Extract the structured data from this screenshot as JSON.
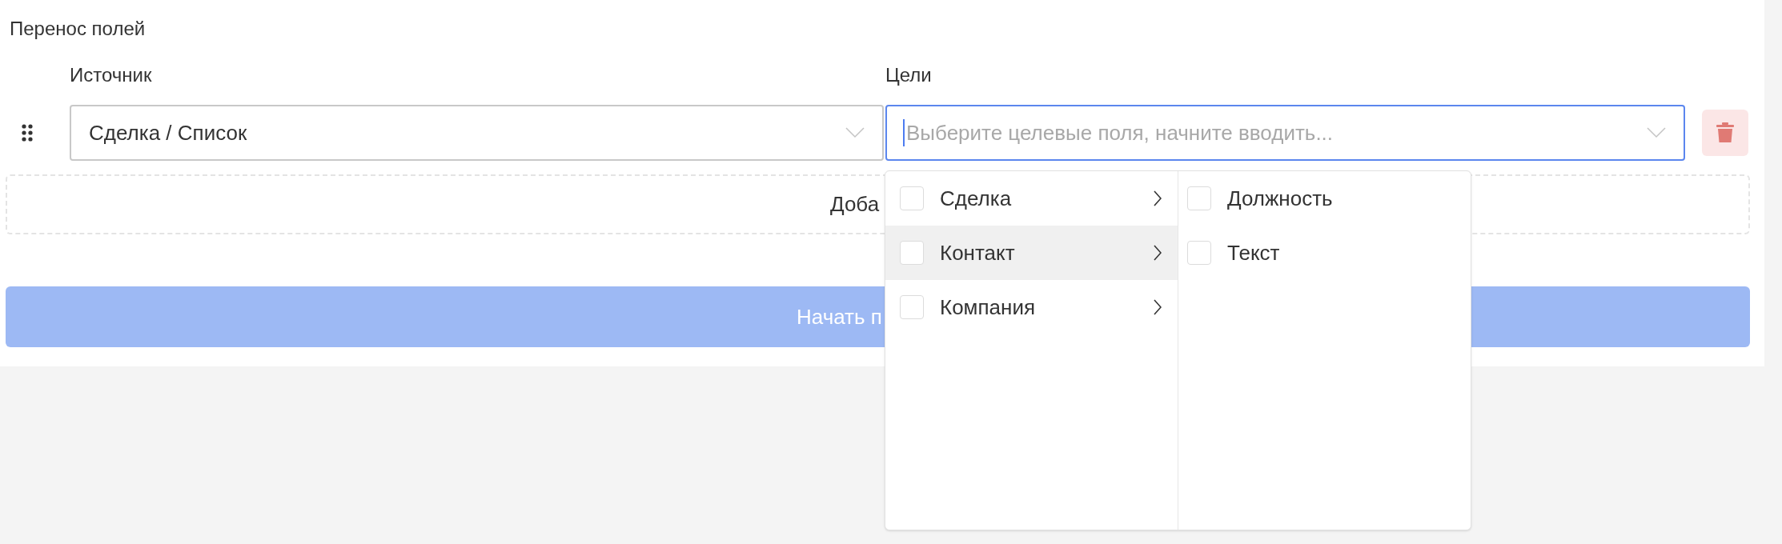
{
  "title": "Перенос полей",
  "source": {
    "label": "Источник",
    "value": "Сделка / Список"
  },
  "targets": {
    "label": "Цели",
    "placeholder": "Выберите целевые поля, начните вводить...",
    "focused": true
  },
  "add_button": {
    "label": "Доба"
  },
  "start_button": {
    "label": "Начать п",
    "disabled": true
  },
  "dropdown": {
    "groups": [
      {
        "label": "Сделка",
        "checked": false,
        "selected": false
      },
      {
        "label": "Контакт",
        "checked": false,
        "selected": true
      },
      {
        "label": "Компания",
        "checked": false,
        "selected": false
      }
    ],
    "fields": [
      {
        "label": "Должность",
        "checked": false
      },
      {
        "label": "Текст",
        "checked": false
      }
    ]
  }
}
